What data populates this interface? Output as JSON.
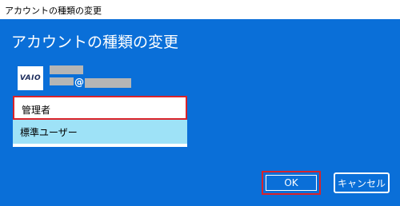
{
  "window": {
    "title": "アカウントの種類の変更"
  },
  "dialog": {
    "heading": "アカウントの種類の変更"
  },
  "account": {
    "logo_text": "VAIO",
    "email_at": "@"
  },
  "account_types": {
    "options": [
      {
        "label": "管理者"
      },
      {
        "label": "標準ユーザー"
      }
    ]
  },
  "buttons": {
    "ok": "OK",
    "cancel": "キャンセル"
  },
  "colors": {
    "background": "#0a6fd8",
    "selected_option": "#9ee2f7",
    "highlight": "#d9232a"
  }
}
